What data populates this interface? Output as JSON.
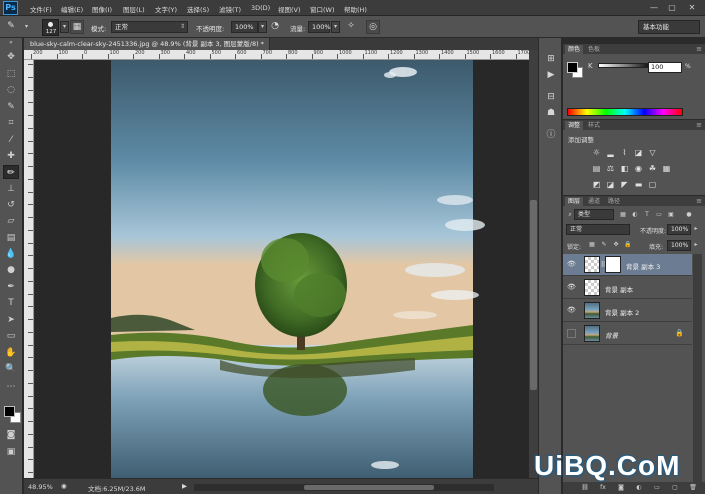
{
  "app": {
    "logo": "Ps",
    "title": "Adobe Photoshop CS6"
  },
  "menu": {
    "items": [
      "文件(F)",
      "编辑(E)",
      "图像(I)",
      "图层(L)",
      "文字(Y)",
      "选择(S)",
      "滤镜(T)",
      "3D(D)",
      "视图(V)",
      "窗口(W)",
      "帮助(H)"
    ],
    "window_controls": [
      "—",
      "▢",
      "✕"
    ]
  },
  "options": {
    "brush_size": "127",
    "mode_label": "模式:",
    "mode_value": "正常",
    "opacity_label": "不透明度:",
    "opacity_value": "100%",
    "flow_label": "流量:",
    "flow_value": "100%",
    "workspace": "基本功能"
  },
  "document": {
    "tab_title": "blue-sky-calm-clear-sky-2451336.jpg @ 48.9% (背景 副本 3, 图层蒙版/8) *",
    "ruler_h_ticks": [
      "200",
      "100",
      "0",
      "100",
      "200",
      "300",
      "400",
      "500",
      "600",
      "700",
      "800",
      "900",
      "1000",
      "1100",
      "1200",
      "1300",
      "1400",
      "1500",
      "1600",
      "1700"
    ]
  },
  "status": {
    "zoom": "48.95%",
    "doc_info": "文档:6.25M/23.6M"
  },
  "tools": [
    "move",
    "marquee",
    "lasso",
    "quick-select",
    "crop",
    "eyedropper",
    "spot-heal",
    "brush",
    "clone-stamp",
    "history-brush",
    "eraser",
    "gradient",
    "blur",
    "dodge",
    "pen",
    "type",
    "path-select",
    "shape",
    "hand",
    "zoom",
    "edit-toolbar",
    "quick-mask",
    "screen-mode"
  ],
  "color_panel": {
    "tabs": [
      "颜色",
      "色板"
    ],
    "channel_label": "K",
    "channel_value": "100",
    "foreground": "#000000",
    "background": "#ffffff"
  },
  "adjust_panel": {
    "tabs": [
      "调整",
      "样式"
    ],
    "title": "添加调整"
  },
  "layers_panel": {
    "tabs": [
      "图层",
      "通道",
      "路径"
    ],
    "filter_kind": "类型",
    "blend_mode": "正常",
    "opacity_label": "不透明度:",
    "opacity_value": "100%",
    "lock_label": "锁定:",
    "fill_label": "填充:",
    "fill_value": "100%",
    "layers": [
      {
        "name": "背景 副本 3",
        "selected": true,
        "has_mask": true
      },
      {
        "name": "背景 副本",
        "selected": false,
        "has_mask": false
      },
      {
        "name": "背景 副本 2",
        "selected": false,
        "has_mask": false
      },
      {
        "name": "背景",
        "selected": false,
        "has_mask": false,
        "locked": true
      }
    ]
  },
  "watermark": {
    "brand": "UiBQ.CoM",
    "text": "实习教程"
  },
  "colors": {
    "accent": "#2f9be6",
    "panel": "#535353",
    "selected_layer": "#6c7c92"
  }
}
